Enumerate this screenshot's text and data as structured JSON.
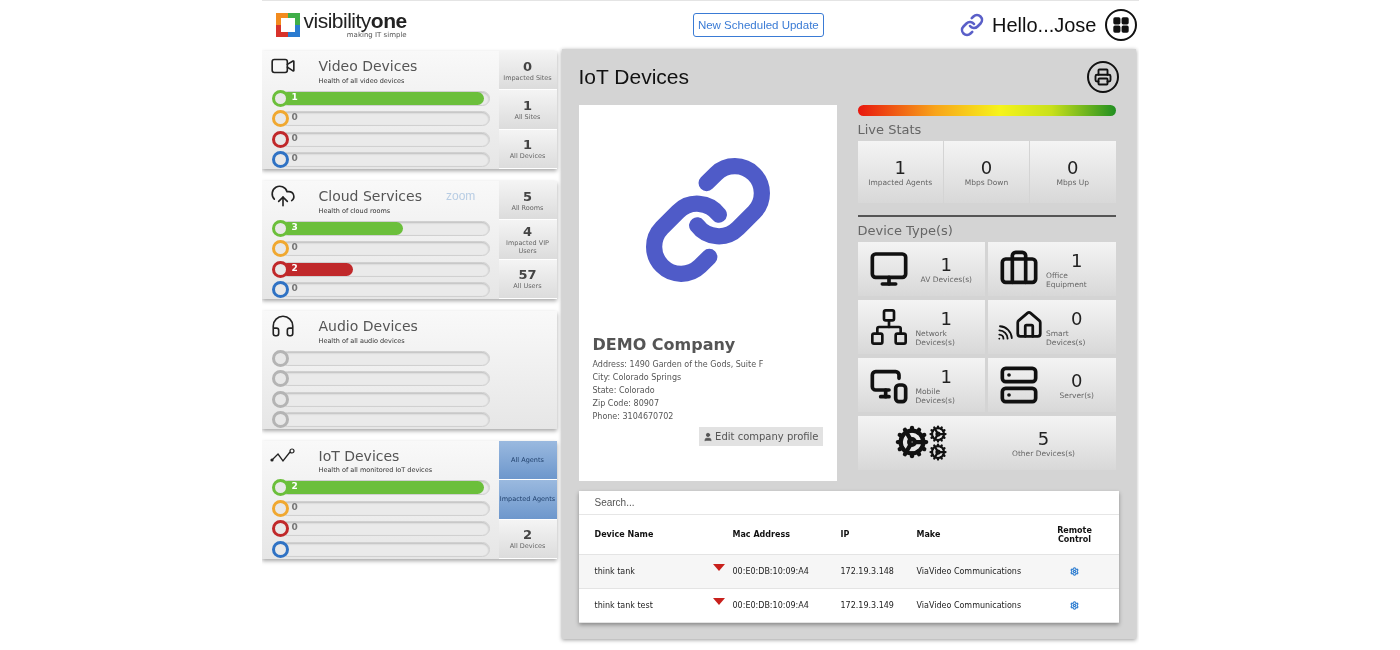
{
  "header": {
    "logo": {
      "name_light": "visibility",
      "name_bold": "one",
      "tagline": "making IT simple"
    },
    "update_button": "New Scheduled Update",
    "greeting": "Hello...Jose"
  },
  "summary_cards": [
    {
      "kind": "video",
      "title": "Video Devices",
      "subtitle": "Health of all video devices",
      "bars": [
        {
          "color": "#6bbf3b",
          "level": 0.98,
          "count": "1"
        },
        {
          "color": "#f0a830",
          "count": "0"
        },
        {
          "color": "#c0282a",
          "count": "0"
        },
        {
          "color": "#2f72c4",
          "count": "0"
        }
      ],
      "stats": [
        {
          "value": "0",
          "label": "Impacted Sites",
          "highlighted": false
        },
        {
          "value": "1",
          "label": "All Sites",
          "highlighted": false
        },
        {
          "value": "1",
          "label": "All Devices",
          "highlighted": false
        }
      ]
    },
    {
      "kind": "cloud",
      "title": "Cloud Services",
      "brand": "zoom",
      "subtitle": "Health of cloud rooms",
      "bars": [
        {
          "color": "#6bbf3b",
          "level": 0.59,
          "count": "3"
        },
        {
          "color": "#f0a830",
          "count": "0"
        },
        {
          "color": "#c0282a",
          "level": 0.35,
          "count": "2"
        },
        {
          "color": "#2f72c4",
          "count": "0"
        }
      ],
      "stats": [
        {
          "value": "5",
          "label": "All Rooms",
          "highlighted": false
        },
        {
          "value": "4",
          "label": "Impacted VIP Users",
          "highlighted": false
        },
        {
          "value": "57",
          "label": "All Users",
          "highlighted": false
        }
      ]
    },
    {
      "kind": "audio",
      "title": "Audio Devices",
      "subtitle": "Health of all audio devices",
      "bars": [
        {
          "color": "#b4b4b4"
        },
        {
          "color": "#b4b4b4"
        },
        {
          "color": "#b4b4b4"
        },
        {
          "color": "#b4b4b4"
        }
      ]
    },
    {
      "kind": "iot",
      "title": "IoT Devices",
      "subtitle": "Health of all monitored IoT devices",
      "bars": [
        {
          "color": "#6bbf3b",
          "level": 0.98,
          "count": "2"
        },
        {
          "color": "#f0a830",
          "count": "0"
        },
        {
          "color": "#c0282a",
          "count": "0"
        },
        {
          "color": "#2f72c4"
        }
      ],
      "stats": [
        {
          "label": "All Agents",
          "highlighted": true
        },
        {
          "label": "Impacted Agents",
          "highlighted": true
        },
        {
          "value": "2",
          "label": "All Devices",
          "highlighted": false
        }
      ]
    }
  ],
  "detail": {
    "title": "IoT Devices",
    "company": {
      "name": "DEMO Company",
      "lines": [
        "Address: 1490 Garden of the Gods, Suite F",
        "City: Colorado Springs",
        "State: Colorado",
        "Zip Code: 80907",
        "Phone: 3104670702"
      ],
      "edit_button": "Edit company profile"
    },
    "live_stats": {
      "heading": "Live Stats",
      "items": [
        {
          "value": "1",
          "label": "Impacted Agents"
        },
        {
          "value": "0",
          "label": "Mbps Down"
        },
        {
          "value": "0",
          "label": "Mbps Up"
        }
      ]
    },
    "device_types": {
      "heading": "Device Type(s)",
      "items": [
        {
          "kind": "av",
          "value": "1",
          "label": "AV Devices(s)"
        },
        {
          "kind": "office",
          "value": "1",
          "label": "Office Equipment"
        },
        {
          "kind": "network",
          "value": "1",
          "label": "Network Devices(s)"
        },
        {
          "kind": "smart",
          "value": "0",
          "label": "Smart Devices(s)"
        },
        {
          "kind": "mobile",
          "value": "1",
          "label": "Mobile Devices(s)"
        },
        {
          "kind": "server",
          "value": "0",
          "label": "Server(s)"
        },
        {
          "kind": "other",
          "value": "5",
          "label": "Other Devices(s)"
        }
      ]
    },
    "table": {
      "search_placeholder": "Search...",
      "columns": [
        "Device Name",
        "Mac Address",
        "IP",
        "Make",
        "Remote Control"
      ],
      "rows": [
        {
          "alert": true,
          "cells": [
            "think tank",
            "00:E0:DB:10:09:A4",
            "172.19.3.148",
            "ViaVideo Communications"
          ]
        },
        {
          "alert": true,
          "cells": [
            "think tank test",
            "00:E0:DB:10:09:A4",
            "172.19.3.149",
            "ViaVideo Communications"
          ]
        }
      ]
    }
  }
}
